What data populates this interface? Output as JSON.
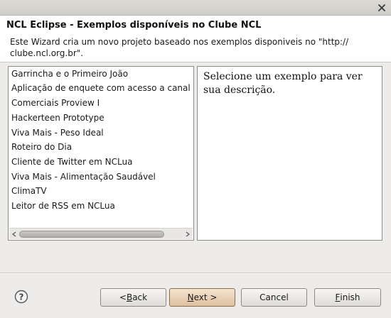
{
  "window": {
    "close_icon": "close-icon"
  },
  "header": {
    "title": "NCL Eclipse - Exemplos disponíveis no Clube NCL",
    "description": "Este Wizard cria um novo projeto baseado nos exemplos disponiveis no \"http:// clube.ncl.org.br\"."
  },
  "examples": {
    "items": [
      "Garrincha e o Primeiro João",
      "Aplicação de enquete com acesso a canal de",
      "Comerciais Proview I",
      "Hackerteen Prototype",
      "Viva Mais - Peso Ideal",
      "Roteiro do Dia",
      "Cliente de Twitter em NCLua",
      "Viva Mais - Alimentação Saudável",
      "ClimaTV",
      "Leitor de RSS em NCLua"
    ]
  },
  "description_panel": {
    "text": "Selecione um exemplo para ver sua descrição."
  },
  "buttons": {
    "help_icon": "help-icon",
    "back": "< Back",
    "back_mnemonic": "B",
    "next": "Next >",
    "next_mnemonic": "N",
    "cancel": "Cancel",
    "finish": "Finish",
    "finish_mnemonic": "F"
  },
  "colors": {
    "dialog_bg": "#edeceb",
    "header_bg": "#ffffff",
    "primary_button": "#ddc09f"
  }
}
